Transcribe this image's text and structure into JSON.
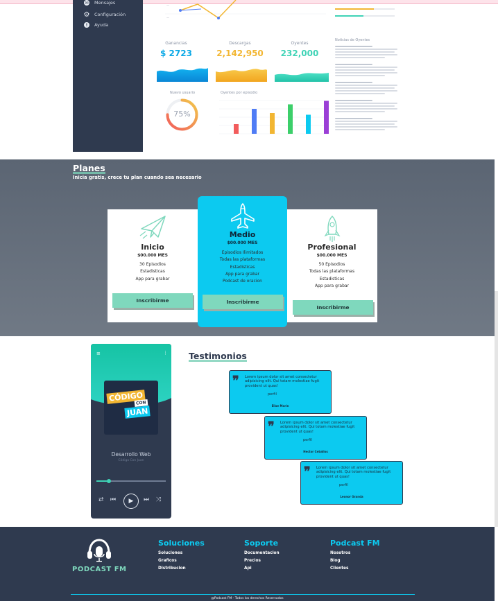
{
  "sidebar": {
    "items": [
      {
        "label": "Mensajes",
        "icon": "message-icon"
      },
      {
        "label": "Configuración",
        "icon": "gear-icon"
      },
      {
        "label": "Ayuda",
        "icon": "info-icon"
      }
    ]
  },
  "stats": [
    {
      "label": "Ganancias",
      "value": "$ 2723",
      "color": "#0aa8e6"
    },
    {
      "label": "Descargas",
      "value": "2,142,950",
      "color": "#f2b632"
    },
    {
      "label": "Oyentes",
      "value": "232,000",
      "color": "#3fd3b6"
    }
  ],
  "gauge": {
    "label": "Nuevo usuario",
    "value": "75%",
    "fraction": 0.75
  },
  "bar_chart": {
    "label": "Oyentes por episodio",
    "values": [
      0.28,
      0.72,
      0.6,
      0.85,
      0.55,
      0.95
    ],
    "colors": [
      "#f25c5c",
      "#4f7cf5",
      "#f2b632",
      "#3ccf6a",
      "#0ccaf0",
      "#9b3fd6"
    ]
  },
  "news": {
    "title": "Noticias de Oyentes",
    "items": 5
  },
  "planes": {
    "title": "Planes",
    "subtitle": "Inicia gratis, crece tu plan cuando sea necesario",
    "cards": [
      {
        "name": "Inicio",
        "price": "$00.000 MES",
        "features": [
          "30 Episodios",
          "Estadisticas",
          "App para grabar"
        ],
        "button": "Inscribirme",
        "icon": "paper-plane-icon"
      },
      {
        "name": "Medio",
        "price": "$00.000 MES",
        "features": [
          "Episodios Ilimitados",
          "Todas las plataformas",
          "Estadisticas",
          "App para grabar",
          "Podcast de oracion"
        ],
        "button": "Inscribirme",
        "icon": "airplane-icon"
      },
      {
        "name": "Profesional",
        "price": "$00.000 MES",
        "features": [
          "50 Episodios",
          "Todas las plataformas",
          "Estadisticas",
          "App para grabar"
        ],
        "button": "Inscribirme",
        "icon": "rocket-icon"
      }
    ]
  },
  "player": {
    "logo_line1": "CÓDIGO",
    "logo_line2": "CON",
    "logo_line3": "JUAN",
    "track": "Desarrollo Web",
    "artist": "Código Con Juan",
    "progress": 0.18
  },
  "testimonios": {
    "title": "Testimonios",
    "items": [
      {
        "text": "Lorem ipsum dolor sit amet consectetur adipisicing elit. Qui totam molestiae fugit provident ut quas!",
        "img_alt": "perfil",
        "name": "Elise Marín"
      },
      {
        "text": "Lorem ipsum dolor sit amet consectetur adipisicing elit. Qui totam molestiae fugit provident ut quas!",
        "img_alt": "perfil",
        "name": "Hector Ceballos"
      },
      {
        "text": "Lorem ipsum dolor sit amet consectetur adipisicing elit. Qui totam molestiae fugit provident ut quas!",
        "img_alt": "perfil",
        "name": "Leonor Granda"
      }
    ]
  },
  "footer": {
    "brand": "PODCAST FM",
    "columns": [
      {
        "title": "Soluciones",
        "links": [
          "Soluciones",
          "Graficos",
          "Distribucion"
        ]
      },
      {
        "title": "Soporte",
        "links": [
          "Documentacion",
          "Precios",
          "Api"
        ]
      },
      {
        "title": "Podcast FM",
        "links": [
          "Nosotros",
          "Blog",
          "Clientes"
        ]
      }
    ],
    "copyright": "@Podcast FM - Todos los derechos Reservados"
  }
}
